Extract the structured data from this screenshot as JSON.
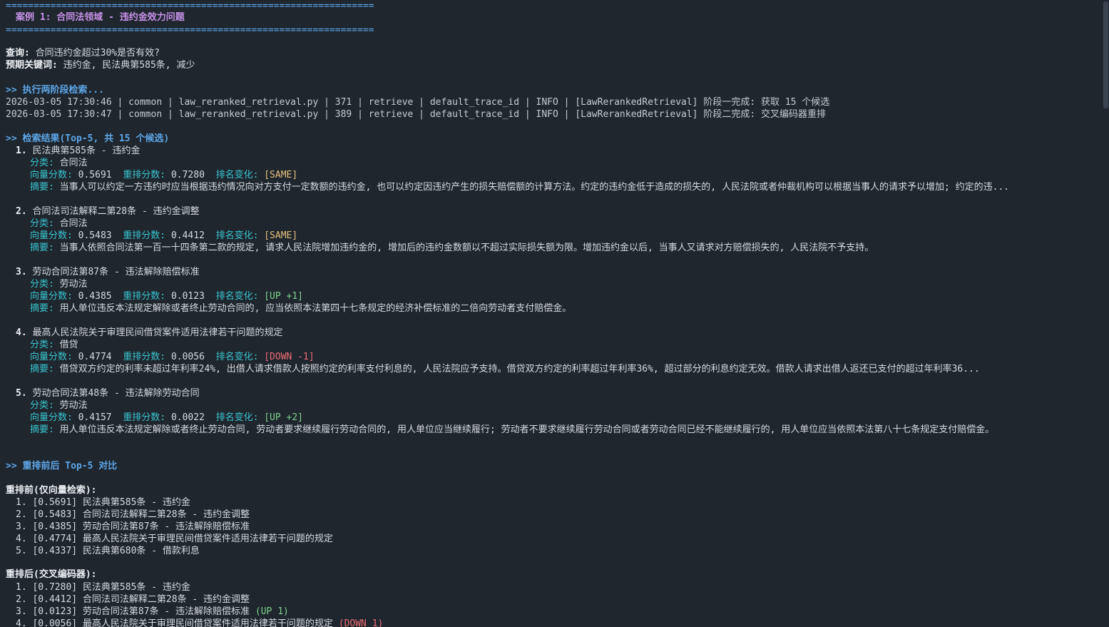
{
  "separator": "==================================================================",
  "case_title": "案例 1: 合同法领域 - 违约金效力问题",
  "query": {
    "label": "查询:",
    "value": "合同违约金超过30%是否有效?"
  },
  "keywords": {
    "label": "预期关键词:",
    "value": "违约金, 民法典第585条, 减少"
  },
  "exec_header": ">> 执行两阶段检索...",
  "logs": [
    "2026-03-05 17:30:46 | common | law_reranked_retrieval.py | 371 | retrieve | default_trace_id | INFO | [LawRerankedRetrieval] 阶段一完成: 获取 15 个候选",
    "2026-03-05 17:30:47 | common | law_reranked_retrieval.py | 389 | retrieve | default_trace_id | INFO | [LawRerankedRetrieval] 阶段二完成: 交叉编码器重排"
  ],
  "results_header": ">> 检索结果(Top-5, 共 15 个候选)",
  "labels": {
    "category": "分类:",
    "vector": "向量分数:",
    "rerank": "重排分数:",
    "change": "排名变化:",
    "summary": "摘要:"
  },
  "results": [
    {
      "num": "1.",
      "title": "民法典第585条 - 违约金",
      "category": "合同法",
      "vector": "0.5691",
      "rerank": "0.7280",
      "change": "[SAME]",
      "change_color": "#e5c07b",
      "summary": "当事人可以约定一方违约时应当根据违约情况向对方支付一定数额的违约金, 也可以约定因违约产生的损失赔偿额的计算方法。约定的违约金低于造成的损失的, 人民法院或者仲裁机构可以根据当事人的请求予以增加; 约定的违..."
    },
    {
      "num": "2.",
      "title": "合同法司法解释二第28条 - 违约金调整",
      "category": "合同法",
      "vector": "0.5483",
      "rerank": "0.4412",
      "change": "[SAME]",
      "change_color": "#e5c07b",
      "summary": "当事人依照合同法第一百一十四条第二款的规定, 请求人民法院增加违约金的, 增加后的违约金数额以不超过实际损失额为限。增加违约金以后, 当事人又请求对方赔偿损失的, 人民法院不予支持。"
    },
    {
      "num": "3.",
      "title": "劳动合同法第87条 - 违法解除赔偿标准",
      "category": "劳动法",
      "vector": "0.4385",
      "rerank": "0.0123",
      "change": "[UP +1]",
      "change_color": "#7fd18b",
      "summary": "用人单位违反本法规定解除或者终止劳动合同的, 应当依照本法第四十七条规定的经济补偿标准的二倍向劳动者支付赔偿金。"
    },
    {
      "num": "4.",
      "title": "最高人民法院关于审理民间借贷案件适用法律若干问题的规定",
      "category": "借贷",
      "vector": "0.4774",
      "rerank": "0.0056",
      "change": "[DOWN -1]",
      "change_color": "#ef6b73",
      "summary": "借贷双方约定的利率未超过年利率24%, 出借人请求借款人按照约定的利率支付利息的, 人民法院应予支持。借贷双方约定的利率超过年利率36%, 超过部分的利息约定无效。借款人请求出借人返还已支付的超过年利率36..."
    },
    {
      "num": "5.",
      "title": "劳动合同法第48条 - 违法解除劳动合同",
      "category": "劳动法",
      "vector": "0.4157",
      "rerank": "0.0022",
      "change": "[UP +2]",
      "change_color": "#7fd18b",
      "summary": "用人单位违反本法规定解除或者终止劳动合同, 劳动者要求继续履行劳动合同的, 用人单位应当继续履行; 劳动者不要求继续履行劳动合同或者劳动合同已经不能继续履行的, 用人单位应当依照本法第八十七条规定支付赔偿金。"
    }
  ],
  "compare_header": ">> 重排前后 Top-5 对比",
  "before": {
    "label": "重排前(仅向量检索):",
    "items": [
      {
        "text": "1. [0.5691] 民法典第585条 - 违约金",
        "tag": ""
      },
      {
        "text": "2. [0.5483] 合同法司法解释二第28条 - 违约金调整",
        "tag": ""
      },
      {
        "text": "3. [0.4385] 劳动合同法第87条 - 违法解除赔偿标准",
        "tag": ""
      },
      {
        "text": "4. [0.4774] 最高人民法院关于审理民间借贷案件适用法律若干问题的规定",
        "tag": ""
      },
      {
        "text": "5. [0.4337] 民法典第680条 - 借款利息",
        "tag": ""
      }
    ]
  },
  "after": {
    "label": "重排后(交叉编码器):",
    "items": [
      {
        "text": "1. [0.7280] 民法典第585条 - 违约金",
        "tag": "",
        "tag_color": ""
      },
      {
        "text": "2. [0.4412] 合同法司法解释二第28条 - 违约金调整",
        "tag": "",
        "tag_color": ""
      },
      {
        "text": "3. [0.0123] 劳动合同法第87条 - 违法解除赔偿标准",
        "tag": "(UP 1)",
        "tag_color": "#7fd18b"
      },
      {
        "text": "4. [0.0056] 最高人民法院关于审理民间借贷案件适用法律若干问题的规定",
        "tag": "(DOWN 1)",
        "tag_color": "#ef6b73"
      }
    ]
  }
}
